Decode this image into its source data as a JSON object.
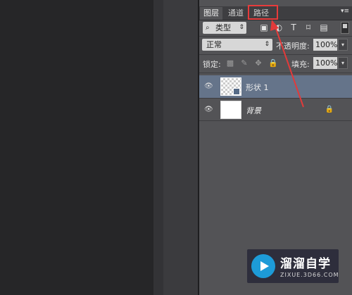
{
  "panel": {
    "tabs": [
      {
        "label": "图层"
      },
      {
        "label": "通道"
      },
      {
        "label": "路径"
      }
    ],
    "menu_icon": "panel-menu-icon"
  },
  "filter": {
    "kind_label": "类型",
    "icons": [
      "image-filter-icon",
      "adjustment-filter-icon",
      "type-filter-icon",
      "shape-filter-icon",
      "smart-object-filter-icon"
    ]
  },
  "blend": {
    "mode": "正常",
    "opacity_label": "不透明度:",
    "opacity_value": "100%"
  },
  "lock": {
    "label": "锁定:",
    "fill_label": "填充:",
    "fill_value": "100%"
  },
  "layers": [
    {
      "name": "形状 1",
      "selected": true
    },
    {
      "name": "背景",
      "selected": false
    }
  ],
  "watermark": {
    "title": "溜溜自学",
    "subtitle": "ZIXUE.3D66.COM"
  },
  "colors": {
    "highlight": "#e83b3b",
    "selected_layer": "#65748a",
    "panel_bg": "#535356"
  }
}
